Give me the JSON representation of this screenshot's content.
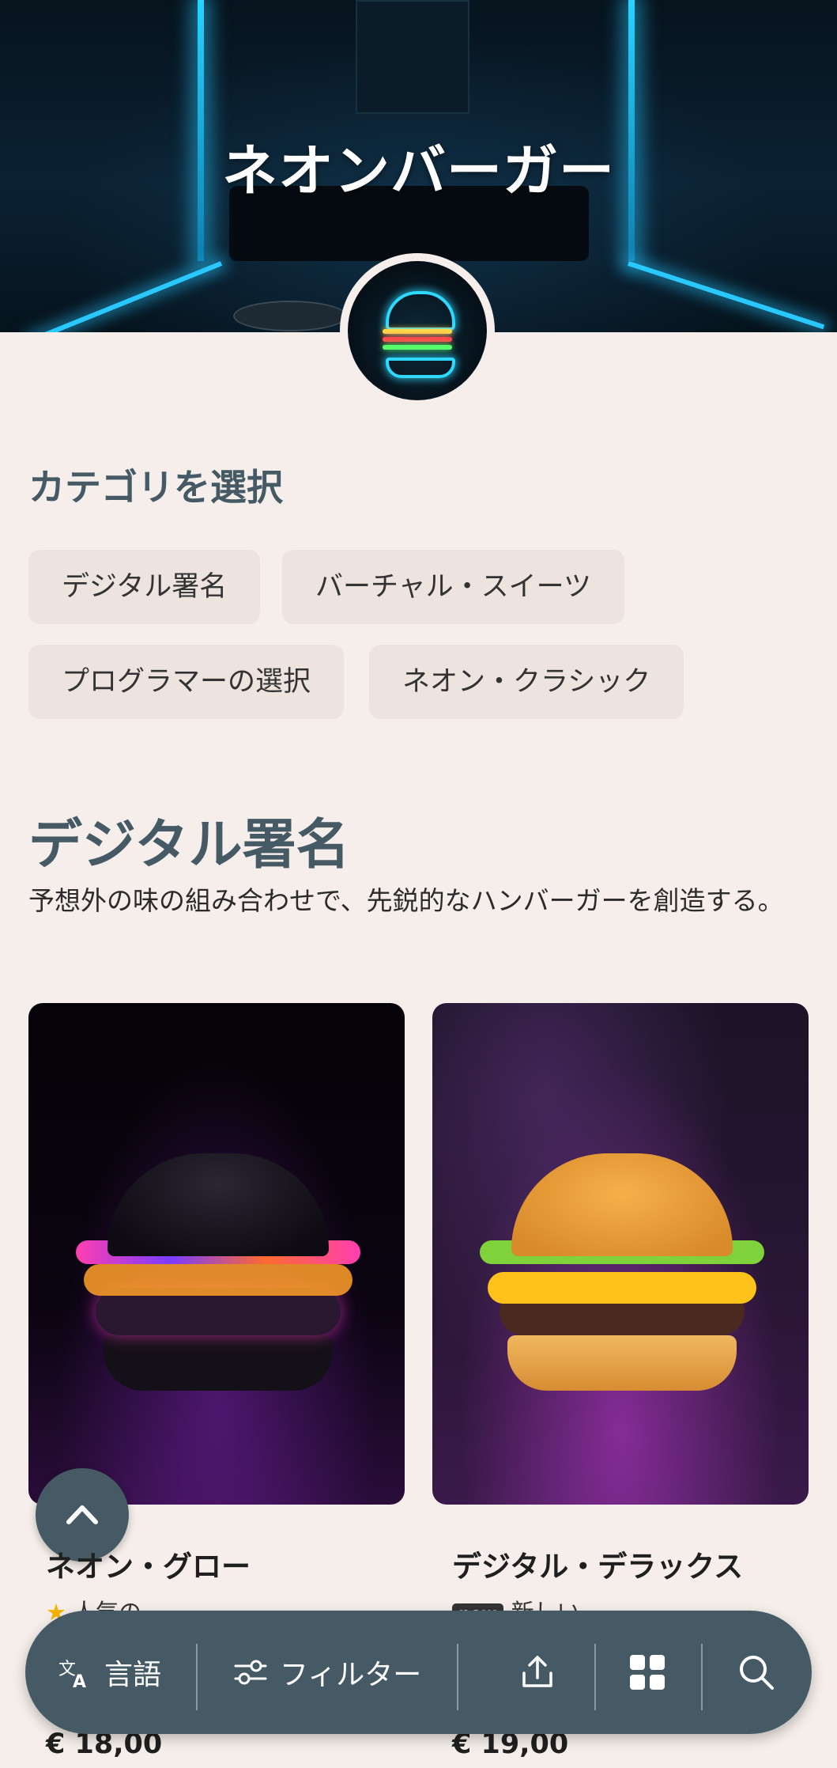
{
  "hero": {
    "title": "ネオンバーガー"
  },
  "category_section": {
    "title": "カテゴリを選択",
    "chips": [
      "デジタル署名",
      "バーチャル・スイーツ",
      "プログラマーの選択",
      "ネオン・クラシック"
    ]
  },
  "menu_section": {
    "title": "デジタル署名",
    "description": "予想外の味の組み合わせで、先鋭的なハンバーガーを創造する。"
  },
  "items": [
    {
      "name": "ネオン・グロー",
      "tag": "人気の",
      "tag_type": "star",
      "price": "€ 18,00"
    },
    {
      "name": "デジタル・デラックス",
      "tag": "新しい",
      "tag_type": "new",
      "badge": "new",
      "price": "€ 19,00"
    }
  ],
  "bottom_bar": {
    "language_label": "言語",
    "filter_label": "フィルター",
    "icons": [
      "translate-icon",
      "filter-icon",
      "share-icon",
      "grid-icon",
      "search-icon"
    ]
  },
  "colors": {
    "background": "#f5eeea",
    "accent": "#455a64",
    "chip": "#ede4df",
    "star": "#f6b400"
  }
}
